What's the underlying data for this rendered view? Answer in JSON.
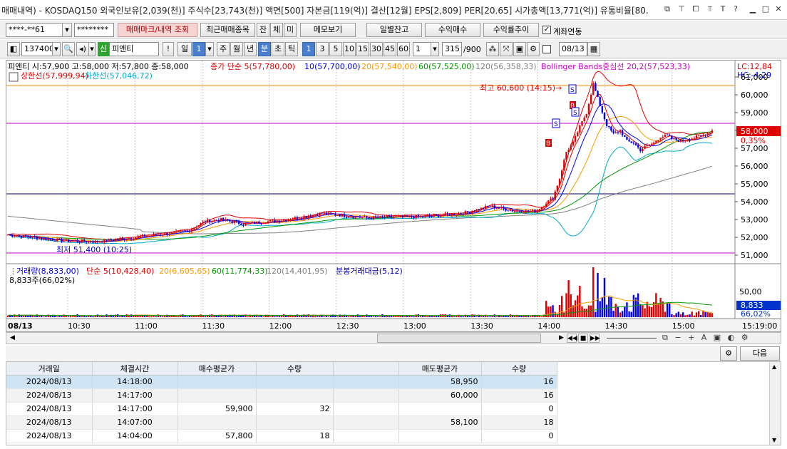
{
  "title": "매매내역) - KOSDAQ150 외국인보유[2,039(천)] 주식수[23,743(천)] 액면[500] 자본금[119(억)] 결산[12월] EPS[2,809] PER[20.65] 시가총액[13,771(억)] 유통비율[80.",
  "toolbar1": {
    "account": "****-**61",
    "password": "********",
    "btn_mark": "매매마크/내역 조회",
    "btn_recent": "최근매매종목",
    "btn_jan": "잔",
    "btn_che": "체",
    "btn_mi": "미",
    "btn_memo": "메모보기",
    "btn_daily": "일별잔고",
    "btn_profit": "수익매수",
    "btn_trend": "수익률추이",
    "account_link_label": "계좌연동"
  },
  "toolbar2": {
    "code": "137400",
    "badge": "신",
    "name": "피엔티",
    "periods": [
      "일",
      "1",
      "주",
      "월",
      "년",
      "분",
      "초",
      "틱"
    ],
    "intervals": [
      "1",
      "3",
      "5",
      "10",
      "15",
      "30",
      "45",
      "60"
    ],
    "interval_sel": "1",
    "count": "315",
    "count_total": "/900",
    "date": "08/13"
  },
  "chart": {
    "info_name": "피엔티",
    "info_ohlc": "시:57,900 고:58,000 저:57,800 종:58,000",
    "ind_jongga": "종가 단순 5(57,780,00)",
    "ind_ma10": "10(57,700,00)",
    "ind_ma20": "20(57,540,00)",
    "ind_ma60": "60(57,525,00)",
    "ind_ma120": "120(56,358,33)",
    "ind_bb": "Bollinger Bands중심선 20,2(57,523,33)",
    "ind_upper": "상한선(57,999,94)",
    "ind_lower": "하한선(57,046,72)",
    "lc": "LC:12,84",
    "hc": "HC:-4,29",
    "high_label": "최고 60,600 (14:15)",
    "low_label": "최저 51,400 (10:25)",
    "price_now": "58,000",
    "price_pct": "0,35%",
    "y_ticks": [
      "61,000",
      "60,000",
      "59,000",
      "58,000",
      "57,000",
      "56,000",
      "55,000",
      "54,000",
      "53,000",
      "52,000",
      "51,000"
    ],
    "vol_ind": "거래량(8,833,00)",
    "vol_ma5": "단순 5(10,428,40)",
    "vol_ma20": "20(6,605,65)",
    "vol_ma60": "60(11,774,33)",
    "vol_ma120": "120(14,401,95)",
    "vol_amt": "분봉거래대금(5,12)",
    "vol_sub": "8,833주(66,02%)",
    "vol_tick": "50,00",
    "vol_now": "8,833",
    "vol_pct": "66,02%",
    "x_first": "08/13",
    "x_ticks": [
      "10:30",
      "11:00",
      "11:30",
      "12:00",
      "12:30",
      "13:00",
      "13:30",
      "14:00",
      "14:30",
      "15:00"
    ],
    "x_end": "15:19:00",
    "colors": {
      "up": "#e00000",
      "down": "#0000ee",
      "ma20": "#ff9900",
      "ma60": "#009900",
      "ma120": "#808080",
      "bb": "#cc00cc",
      "upper": "#e00000",
      "lower": "#00aacc"
    }
  },
  "bottom": {
    "next_label": "다음"
  },
  "table": {
    "headers": [
      "거래일",
      "체결시간",
      "매수평균가",
      "수량",
      "",
      "매도평균가",
      "수량"
    ],
    "rows": [
      [
        "2024/08/13",
        "14:18:00",
        "",
        "",
        "",
        "58,950",
        "16"
      ],
      [
        "2024/08/13",
        "14:17:00",
        "",
        "",
        "",
        "60,000",
        "16"
      ],
      [
        "2024/08/13",
        "14:17:00",
        "59,900",
        "32",
        "",
        "",
        "0"
      ],
      [
        "2024/08/13",
        "14:07:00",
        "",
        "",
        "",
        "58,100",
        "18"
      ],
      [
        "2024/08/13",
        "14:04:00",
        "57,800",
        "18",
        "",
        "",
        "0"
      ]
    ]
  }
}
